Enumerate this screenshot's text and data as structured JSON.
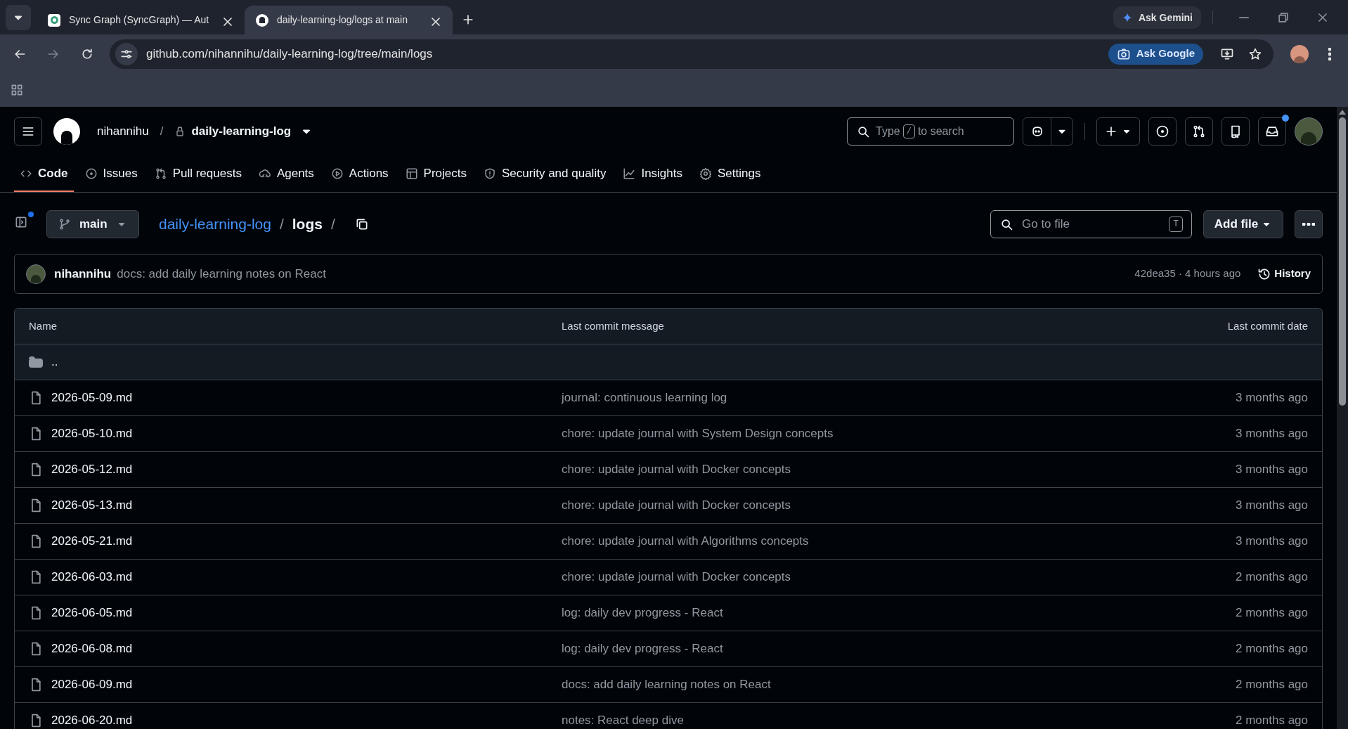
{
  "browser": {
    "tabs": [
      {
        "title": "Sync Graph (SyncGraph) — Aut",
        "selected": false
      },
      {
        "title": "daily-learning-log/logs at main",
        "selected": true
      }
    ],
    "ask_gemini": "Ask Gemini",
    "url": "github.com/nihannihu/daily-learning-log/tree/main/logs",
    "ask_google": "Ask Google"
  },
  "header": {
    "owner": "nihannihu",
    "separator": "/",
    "repo": "daily-learning-log",
    "search": {
      "before": "Type",
      "key": "/",
      "after": "to search"
    },
    "notification": true
  },
  "nav": [
    {
      "label": "Code",
      "selected": true
    },
    {
      "label": "Issues",
      "selected": false
    },
    {
      "label": "Pull requests",
      "selected": false
    },
    {
      "label": "Agents",
      "selected": false
    },
    {
      "label": "Actions",
      "selected": false
    },
    {
      "label": "Projects",
      "selected": false
    },
    {
      "label": "Security and quality",
      "selected": false
    },
    {
      "label": "Insights",
      "selected": false
    },
    {
      "label": "Settings",
      "selected": false
    }
  ],
  "toolbar": {
    "branch": "main",
    "path": [
      {
        "label": "daily-learning-log",
        "kind": "link"
      },
      {
        "label": "/",
        "kind": "sep"
      },
      {
        "label": "logs",
        "kind": "current"
      },
      {
        "label": "/",
        "kind": "sep"
      }
    ],
    "go_to_file": "Go to file",
    "shortcut": "T",
    "add_file": "Add file"
  },
  "commit": {
    "author": "nihannihu",
    "message": "docs: add daily learning notes on React",
    "hash_time": "42dea35 · 4 hours ago",
    "history": "History"
  },
  "table": {
    "columns": [
      "Name",
      "Last commit message",
      "Last commit date"
    ],
    "parent": "..",
    "rows": [
      {
        "name": "2026-05-09.md",
        "message": "journal: continuous learning log",
        "date": "3 months ago"
      },
      {
        "name": "2026-05-10.md",
        "message": "chore: update journal with System Design concepts",
        "date": "3 months ago"
      },
      {
        "name": "2026-05-12.md",
        "message": "chore: update journal with Docker concepts",
        "date": "3 months ago"
      },
      {
        "name": "2026-05-13.md",
        "message": "chore: update journal with Docker concepts",
        "date": "3 months ago"
      },
      {
        "name": "2026-05-21.md",
        "message": "chore: update journal with Algorithms concepts",
        "date": "3 months ago"
      },
      {
        "name": "2026-06-03.md",
        "message": "chore: update journal with Docker concepts",
        "date": "2 months ago"
      },
      {
        "name": "2026-06-05.md",
        "message": "log: daily dev progress - React",
        "date": "2 months ago"
      },
      {
        "name": "2026-06-08.md",
        "message": "log: daily dev progress - React",
        "date": "2 months ago"
      },
      {
        "name": "2026-06-09.md",
        "message": "docs: add daily learning notes on React",
        "date": "2 months ago"
      },
      {
        "name": "2026-06-20.md",
        "message": "notes: React deep dive",
        "date": "2 months ago"
      }
    ]
  }
}
